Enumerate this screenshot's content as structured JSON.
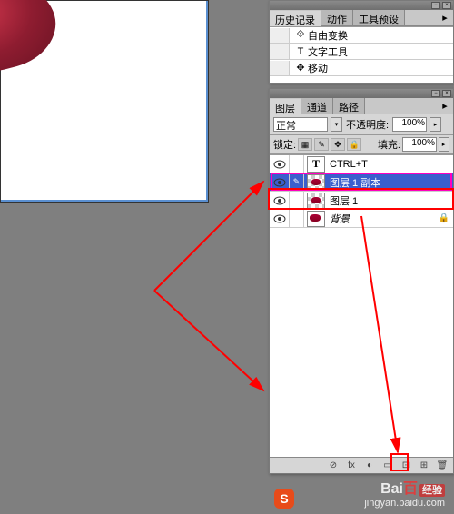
{
  "history_panel": {
    "tabs": [
      "历史记录",
      "动作",
      "工具预设"
    ],
    "items": [
      {
        "icon": "⟐",
        "label": "自由变换"
      },
      {
        "icon": "T",
        "label": "文字工具"
      },
      {
        "icon": "✥",
        "label": "移动"
      }
    ]
  },
  "layers_panel": {
    "tabs": [
      "图层",
      "通道",
      "路径"
    ],
    "blend_mode": "正常",
    "opacity_label": "不透明度:",
    "opacity_value": "100%",
    "lock_label": "锁定:",
    "fill_label": "填充:",
    "fill_value": "100%",
    "layers": [
      {
        "visible": true,
        "link": "",
        "thumb": "text",
        "name": "CTRL+T",
        "locked": false,
        "selected": false
      },
      {
        "visible": true,
        "link": "✎",
        "thumb": "trans",
        "name": "图层 1 副本",
        "locked": false,
        "selected": true
      },
      {
        "visible": true,
        "link": "",
        "thumb": "trans",
        "name": "图层 1",
        "locked": false,
        "selected": false
      },
      {
        "visible": true,
        "link": "",
        "thumb": "white",
        "name": "背景",
        "locked": true,
        "selected": false
      }
    ],
    "footer_icons": [
      "⊘",
      "fx",
      "◐",
      "▭",
      "⊡",
      "⊞",
      "🗑"
    ]
  },
  "watermark": {
    "logo_a": "Bai",
    "logo_b": "百",
    "logo_suffix": "经验",
    "url": "jingyan.baidu.com"
  },
  "taskbar": {
    "icon_letter": "S"
  },
  "colors": {
    "selected_bg": "#3a5fcd",
    "magenta": "#ff00c0",
    "red": "#ff0000"
  }
}
